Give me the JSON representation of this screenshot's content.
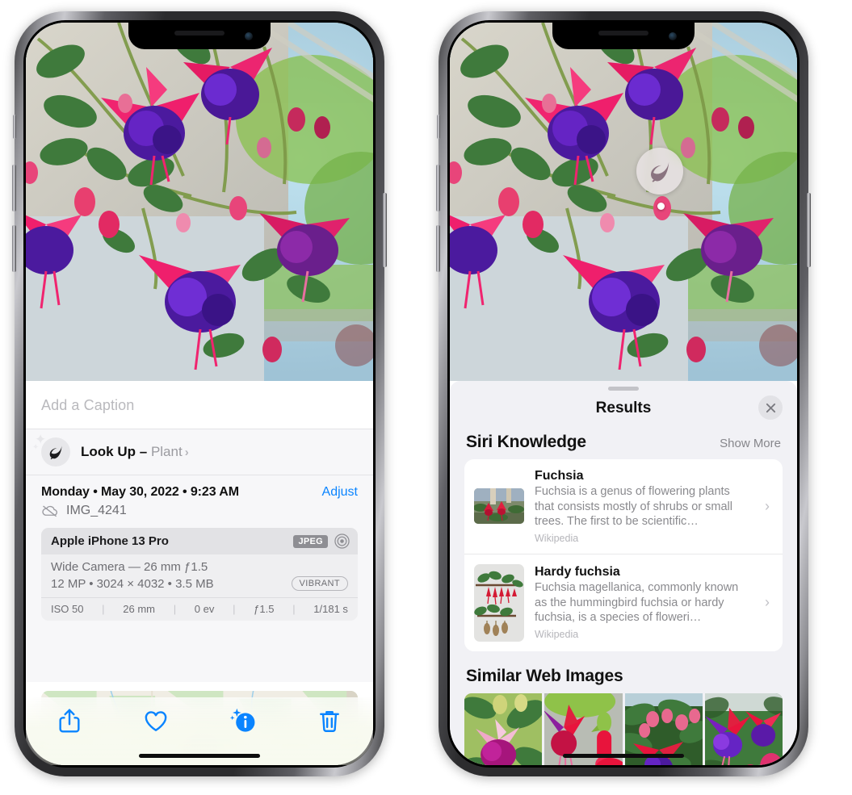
{
  "left_phone": {
    "name": "iphone-photos-info",
    "caption_placeholder": "Add a Caption",
    "lookup": {
      "label": "Look Up",
      "dash": "–",
      "subject": "Plant",
      "chevron": "›",
      "icon": "leaf-icon"
    },
    "date_line": "Monday • May 30, 2022 • 9:23 AM",
    "adjust_label": "Adjust",
    "file_name": "IMG_4241",
    "cloud_icon": "cloud-slash-icon",
    "exif": {
      "device": "Apple iPhone 13 Pro",
      "format_tag": "JPEG",
      "raw_icon": "raw-ring-icon",
      "lens_line": "Wide Camera — 26 mm ƒ1.5",
      "size_line": "12 MP • 3024 × 4032 • 3.5 MB",
      "style_tag": "VIBRANT",
      "stats": [
        "ISO 50",
        "26 mm",
        "0 ev",
        "ƒ1.5",
        "1/181 s"
      ]
    },
    "toolbar": [
      {
        "name": "share-icon",
        "label": "Share"
      },
      {
        "name": "heart-icon",
        "label": "Favorite"
      },
      {
        "name": "info-sparkle-icon",
        "label": "Info"
      },
      {
        "name": "trash-icon",
        "label": "Delete"
      }
    ]
  },
  "right_phone": {
    "name": "iphone-visual-lookup-results",
    "visual_badge_icon": "leaf-icon",
    "sheet": {
      "title": "Results",
      "close_icon": "close-icon"
    },
    "siri_knowledge": {
      "title": "Siri Knowledge",
      "show_more": "Show More",
      "cards": [
        {
          "title": "Fuchsia",
          "description": "Fuchsia is a genus of flowering plants that consists mostly of shrubs or small trees. The first to be scientific…",
          "source": "Wikipedia",
          "chevron": "›"
        },
        {
          "title": "Hardy fuchsia",
          "description": "Fuchsia magellanica, commonly known as the hummingbird fuchsia or hardy fuchsia, is a species of floweri…",
          "source": "Wikipedia",
          "chevron": "›"
        }
      ]
    },
    "similar_web_images": {
      "title": "Similar Web Images",
      "count": 4
    }
  },
  "colors": {
    "accent_blue": "#0a84ff",
    "sheet_bg": "#f1f1f5",
    "card_bg": "#ffffff",
    "muted_text": "#8a8a8e",
    "tag_grey": "#8e8e93"
  }
}
